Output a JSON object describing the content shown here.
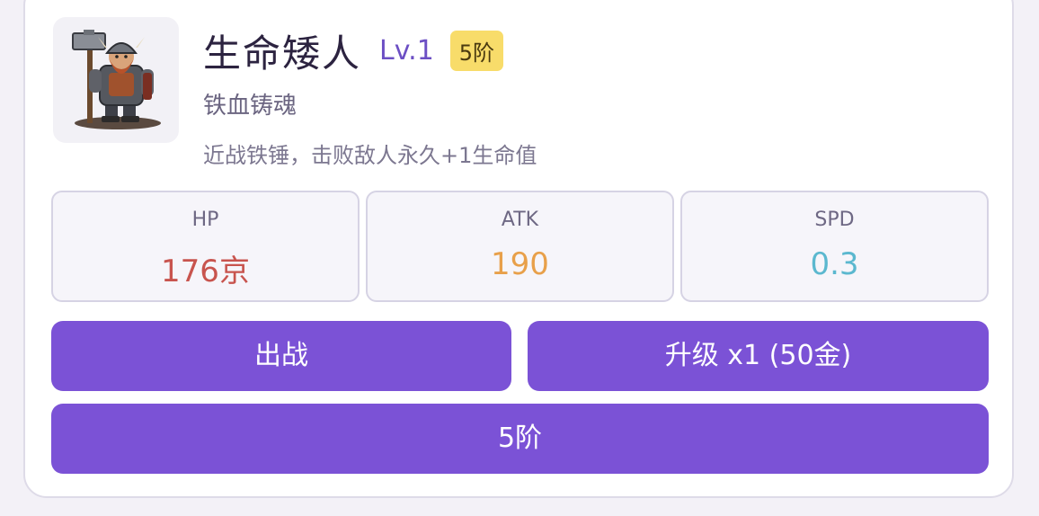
{
  "hero": {
    "name": "生命矮人",
    "level": "Lv.1",
    "tier_badge": "5阶",
    "subtitle": "铁血铸魂",
    "description": "近战铁锤，击败敌人永久+1生命值"
  },
  "stats": [
    {
      "label": "HP",
      "value": "176京",
      "color": "#c8544e"
    },
    {
      "label": "ATK",
      "value": "190",
      "color": "#e8a04a"
    },
    {
      "label": "SPD",
      "value": "0.3",
      "color": "#5bb8cf"
    }
  ],
  "buttons": {
    "deploy": "出战",
    "upgrade": "升级 x1 (50金)",
    "tier": "5阶"
  },
  "colors": {
    "accent": "#7b52d6",
    "badge": "#f8dc6a"
  }
}
